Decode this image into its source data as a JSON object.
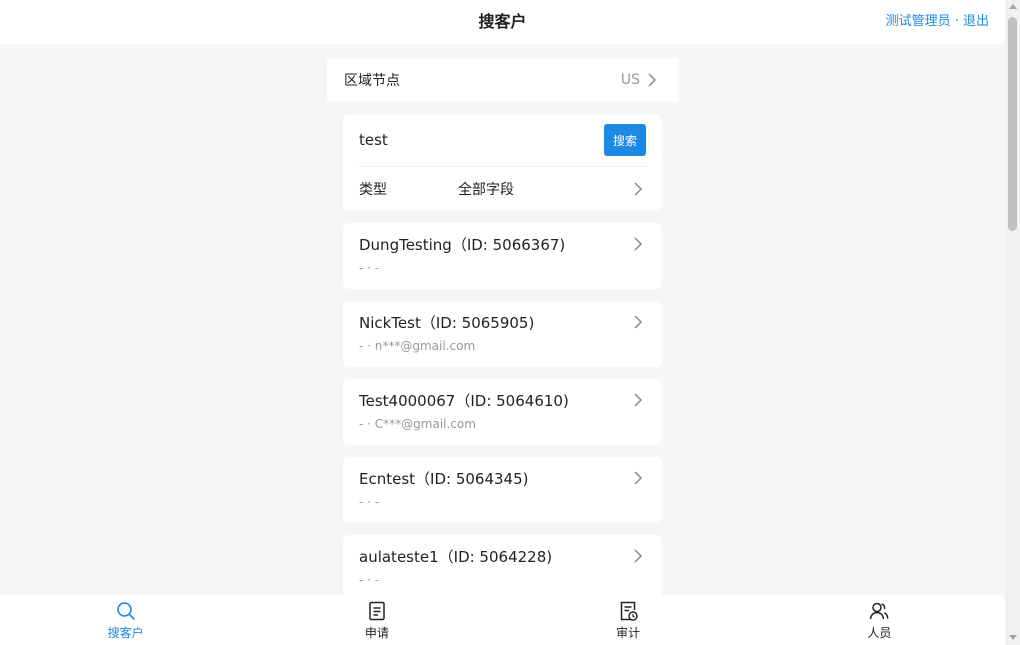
{
  "header": {
    "title": "搜客户",
    "user_name": "测试管理员",
    "separator": " · ",
    "logout_label": "退出"
  },
  "region": {
    "label": "区域节点",
    "value": "US"
  },
  "search": {
    "query": "test",
    "button_label": "搜索",
    "type_label": "类型",
    "type_value": "全部字段"
  },
  "results": [
    {
      "name": "DungTesting",
      "id_text": "（ID: 5066367)",
      "sub": "- · -"
    },
    {
      "name": "NickTest",
      "id_text": "（ID: 5065905)",
      "sub": "- · n***@gmail.com"
    },
    {
      "name": "Test4000067",
      "id_text": "（ID: 5064610)",
      "sub": "- · C***@gmail.com"
    },
    {
      "name": "Ecntest",
      "id_text": "（ID: 5064345)",
      "sub": "- · -"
    },
    {
      "name": "aulateste1",
      "id_text": "（ID: 5064228)",
      "sub": "- · -"
    }
  ],
  "tabs": [
    {
      "label": "搜客户",
      "icon": "search-icon"
    },
    {
      "label": "申请",
      "icon": "document-icon"
    },
    {
      "label": "审计",
      "icon": "audit-icon"
    },
    {
      "label": "人员",
      "icon": "people-icon"
    }
  ],
  "colors": {
    "accent": "#1e88e5",
    "background": "#f5f6f8",
    "muted_text": "#999999"
  }
}
